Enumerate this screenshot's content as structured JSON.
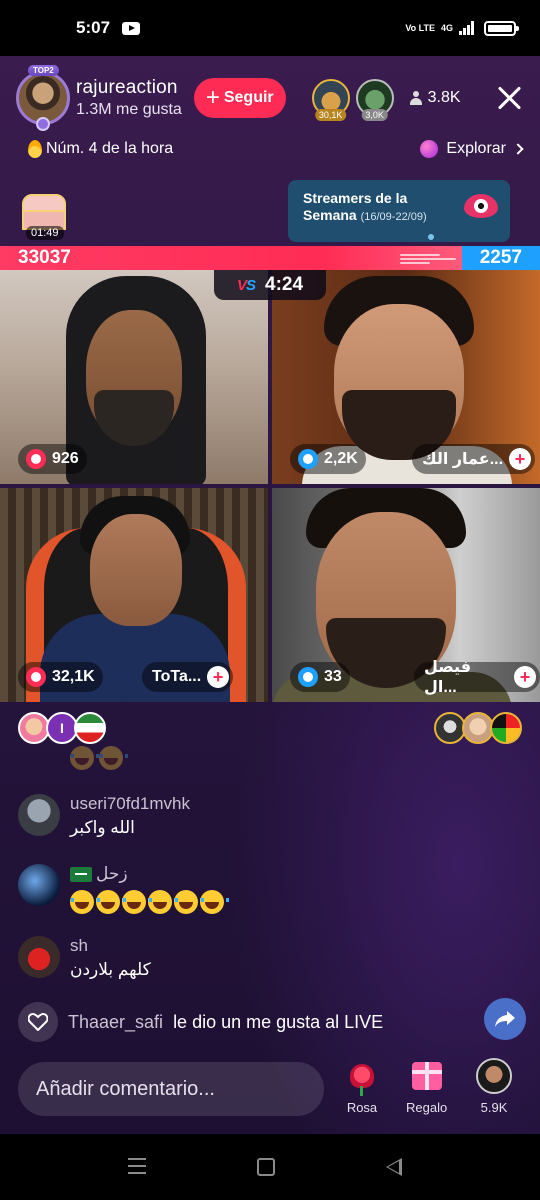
{
  "status_bar": {
    "time": "5:07",
    "network_labels": "Vo LTE",
    "network_type": "4G"
  },
  "host": {
    "badge": "TOP2",
    "name": "rajureaction",
    "likes": "1.3M me gusta",
    "follow_label": "Seguir",
    "top_gifters": [
      {
        "count": "30,1K",
        "color": "#e7b53a"
      },
      {
        "count": "3,0K",
        "color": "#bbbbbb"
      }
    ],
    "viewers": "3.8K"
  },
  "rank": {
    "label": "Núm. 4 de la hora"
  },
  "explore": {
    "label": "Explorar"
  },
  "chest": {
    "timer": "01:49"
  },
  "banner": {
    "title_line1": "Streamers de la",
    "title_line2": "Semana",
    "dates": "(16/09-22/09)"
  },
  "battle": {
    "score_left": "33037",
    "score_right": "2257",
    "vs": "VS",
    "timer": "4:24",
    "left_color": "#ff2c55",
    "right_color": "#1ea0ff"
  },
  "guests": [
    {
      "points": "926",
      "team": "red",
      "name": ""
    },
    {
      "points": "2,2K",
      "team": "blue",
      "name": "عمار الك..."
    },
    {
      "points": "32,1K",
      "team": "red",
      "name": "ToTa..."
    },
    {
      "points": "33",
      "team": "blue",
      "name": "فيصل ال..."
    }
  ],
  "viewer_row": {
    "middle_initial": "I"
  },
  "comments": [
    {
      "user": "useri70fd1mvhk",
      "text": "الله واكبر"
    },
    {
      "user": "زحل",
      "text": ""
    },
    {
      "user": "sh",
      "text": "كلهم بلاردن"
    }
  ],
  "like_notice": {
    "user": "Thaaer_safi",
    "text": "le dio un me gusta al LIVE"
  },
  "bottom": {
    "comment_placeholder": "Añadir comentario...",
    "rose_label": "Rosa",
    "gift_label": "Regalo",
    "profile_label": "5.9K"
  }
}
